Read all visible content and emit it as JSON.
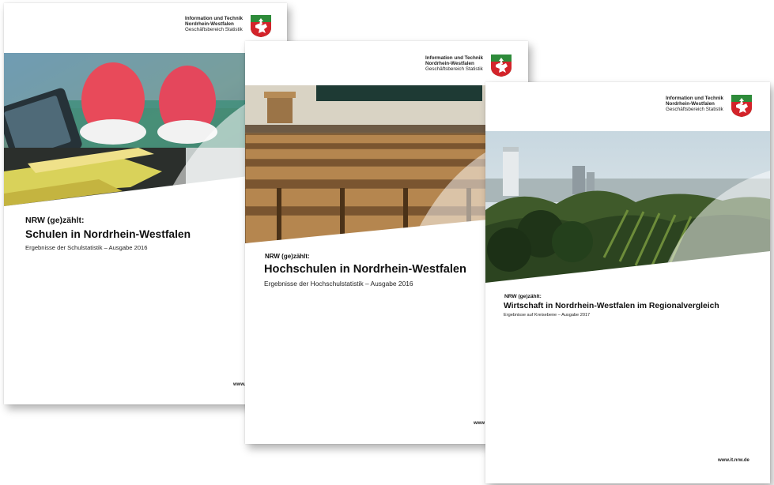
{
  "publisher": {
    "line1": "Information und Technik",
    "line2": "Nordrhein-Westfalen",
    "line3": "Geschäftsbereich Statistik"
  },
  "covers": [
    {
      "kicker": "NRW (ge)zählt:",
      "title": "Schulen in Nordrhein-Westfalen",
      "subtitle": "Ergebnisse der Schulstatistik – Ausgabe 2016",
      "url": "www."
    },
    {
      "kicker": "NRW (ge)zählt:",
      "title": "Hochschulen in Nordrhein-Westfalen",
      "subtitle": "Ergebnisse der Hochschulstatistik – Ausgabe 2016",
      "url": "www"
    },
    {
      "kicker": "NRW (ge)zählt:",
      "title": "Wirtschaft in Nordrhein-Westfalen im Regionalvergleich",
      "subtitle": "Ergebnisse auf Kreisebene – Ausgabe 2017",
      "url": "www.it.nrw.de"
    }
  ],
  "colors": {
    "crest_green": "#2e8b3a",
    "crest_red": "#d3232a",
    "crest_white": "#ffffff"
  }
}
